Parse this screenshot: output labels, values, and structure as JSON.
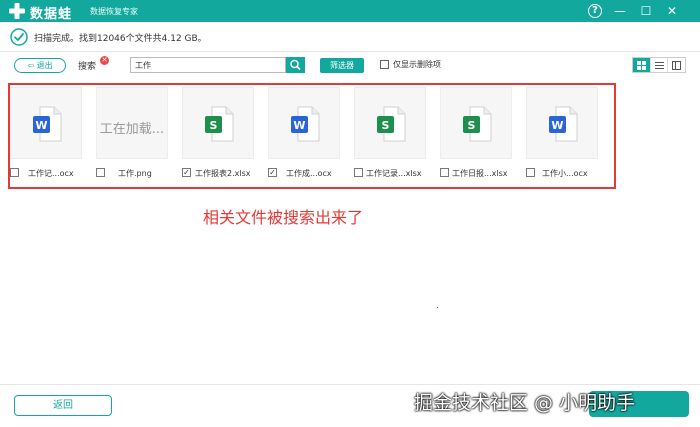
{
  "app": {
    "name": "数据蛙",
    "subtitle": "数据恢复专家",
    "help_label": "?",
    "minimize_label": "—",
    "maximize_label": "☐",
    "close_label": "✕"
  },
  "status": {
    "text": "扫描完成。找到12046个文件共4.12 GB。"
  },
  "toolbar": {
    "exit_label": "退出",
    "search_label": "搜索",
    "search_value": "工作",
    "filter_label": "筛选器",
    "deleted_only_label": "仅显示删除项"
  },
  "results": {
    "loading_text": "工在加载...",
    "items": [
      {
        "name": "工作记...ocx",
        "type": "word",
        "checked": false
      },
      {
        "name": "工作.png",
        "type": "image",
        "checked": false
      },
      {
        "name": "工作报表2.xlsx",
        "type": "excel",
        "checked": true
      },
      {
        "name": "工作成...ocx",
        "type": "word",
        "checked": true
      },
      {
        "name": "工作记录...xlsx",
        "type": "excel",
        "checked": false
      },
      {
        "name": "工作日报...xlsx",
        "type": "excel",
        "checked": false
      },
      {
        "name": "工作小...ocx",
        "type": "word",
        "checked": false
      }
    ]
  },
  "annotation": "相关文件被搜索出来了",
  "footer": {
    "back_label": "返回",
    "watermark": "掘金技术社区 @ 小明助手"
  },
  "colors": {
    "brand": "#13a89e",
    "highlight": "#e53935",
    "word": "#2b63d9",
    "excel": "#1f8f4e"
  }
}
